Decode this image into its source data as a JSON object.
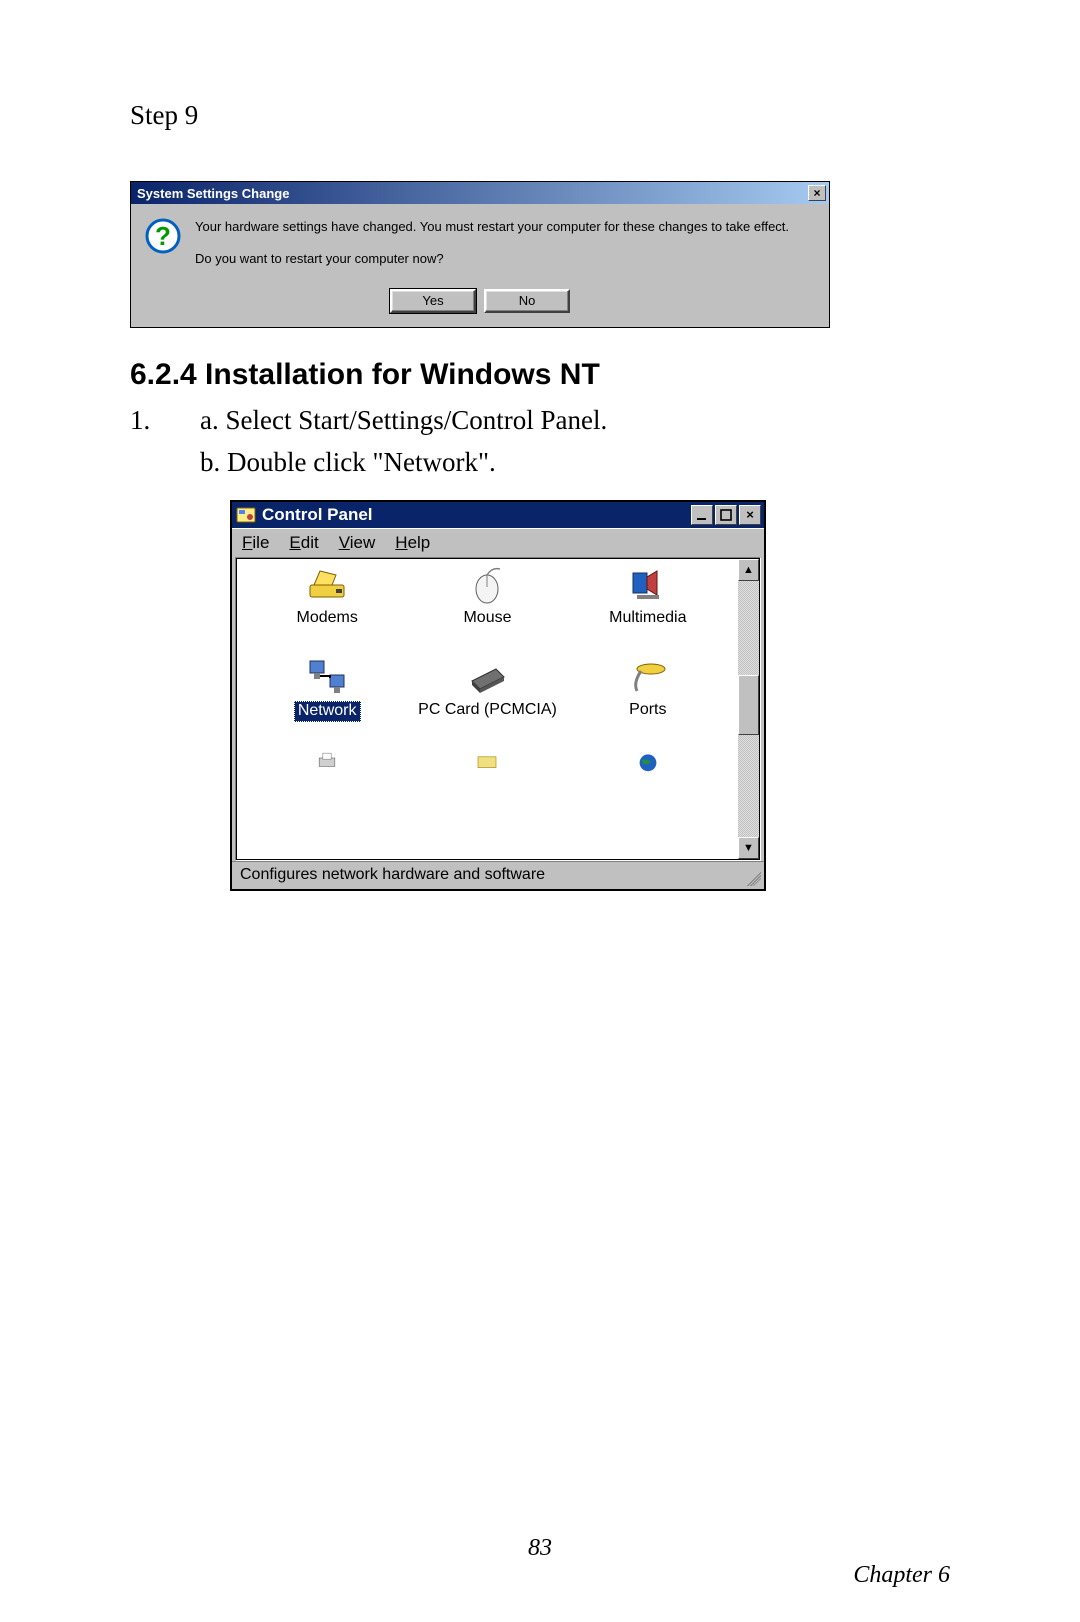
{
  "step_label": "Step 9",
  "dialog1": {
    "title": "System Settings Change",
    "line1": "Your hardware settings have changed. You must restart your computer for these changes to take effect.",
    "line2": "Do you want to restart your computer now?",
    "yes": "Yes",
    "no": "No"
  },
  "heading": "6.2.4 Installation for Windows NT",
  "list": {
    "num": "1.",
    "a": "a. Select Start/Settings/Control Panel.",
    "b": "b. Double click \"Network\"."
  },
  "cp": {
    "title": "Control Panel",
    "menu": {
      "file": "File",
      "edit": "Edit",
      "view": "View",
      "help": "Help"
    },
    "items": [
      {
        "label": "Modems"
      },
      {
        "label": "Mouse"
      },
      {
        "label": "Multimedia"
      },
      {
        "label": "Network",
        "selected": true
      },
      {
        "label": "PC Card (PCMCIA)"
      },
      {
        "label": "Ports"
      }
    ],
    "status": "Configures network hardware and software"
  },
  "footer": {
    "page": "83",
    "chapter": "Chapter 6"
  }
}
